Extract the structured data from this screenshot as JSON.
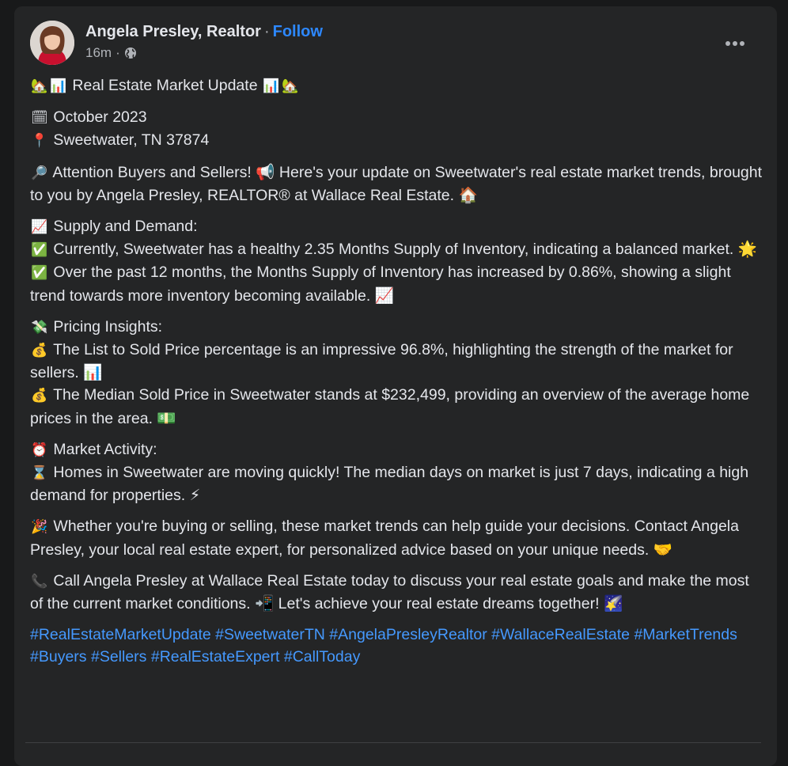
{
  "post": {
    "author": "Angela Presley, Realtor",
    "separator": "·",
    "follow_label": "Follow",
    "timestamp": "16m",
    "meta_separator": "·",
    "privacy_icon": "globe-icon",
    "more_icon": "more-options-icon"
  },
  "content": {
    "title": "Real Estate Market Update",
    "date": "October 2023",
    "location": "Sweetwater, TN 37874",
    "intro": "Attention Buyers and Sellers! 📢 Here's your update on Sweetwater's real estate market trends, brought to you by Angela Presley, REALTOR® at Wallace Real Estate. 🏠",
    "supply_heading": "Supply and Demand:",
    "supply_1": "Currently, Sweetwater has a healthy 2.35 Months Supply of Inventory, indicating a balanced market. 🌟",
    "supply_2": "Over the past 12 months, the Months Supply of Inventory has increased by 0.86%, showing a slight trend towards more inventory becoming available. 📈",
    "pricing_heading": "Pricing Insights:",
    "pricing_1": "The List to Sold Price percentage is an impressive 96.8%, highlighting the strength of the market for sellers. 📊",
    "pricing_2": "The Median Sold Price in Sweetwater stands at $232,499, providing an overview of the average home prices in the area. 💵",
    "activity_heading": "Market Activity:",
    "activity_1": "Homes in Sweetwater are moving quickly! The median days on market is just 7 days, indicating a high demand for properties. ⚡",
    "closing_1": "Whether you're buying or selling, these market trends can help guide your decisions. Contact Angela Presley, your local real estate expert, for personalized advice based on your unique needs. 🤝",
    "closing_2": "Call Angela Presley at Wallace Real Estate today to discuss your real estate goals and make the most of the current market conditions. 📲 Let's achieve your real estate dreams together! 🌠"
  },
  "hashtags": [
    "#RealEstateMarketUpdate",
    "#SweetwaterTN",
    "#AngelaPresleyRealtor",
    "#WallaceRealEstate",
    "#MarketTrends",
    "#Buyers",
    "#Sellers",
    "#RealEstateExpert",
    "#CallToday"
  ],
  "colors": {
    "background": "#18191a",
    "card": "#242526",
    "text": "#e4e6eb",
    "secondary": "#b0b3b8",
    "link": "#2d88ff",
    "hashtag": "#4599ff"
  }
}
